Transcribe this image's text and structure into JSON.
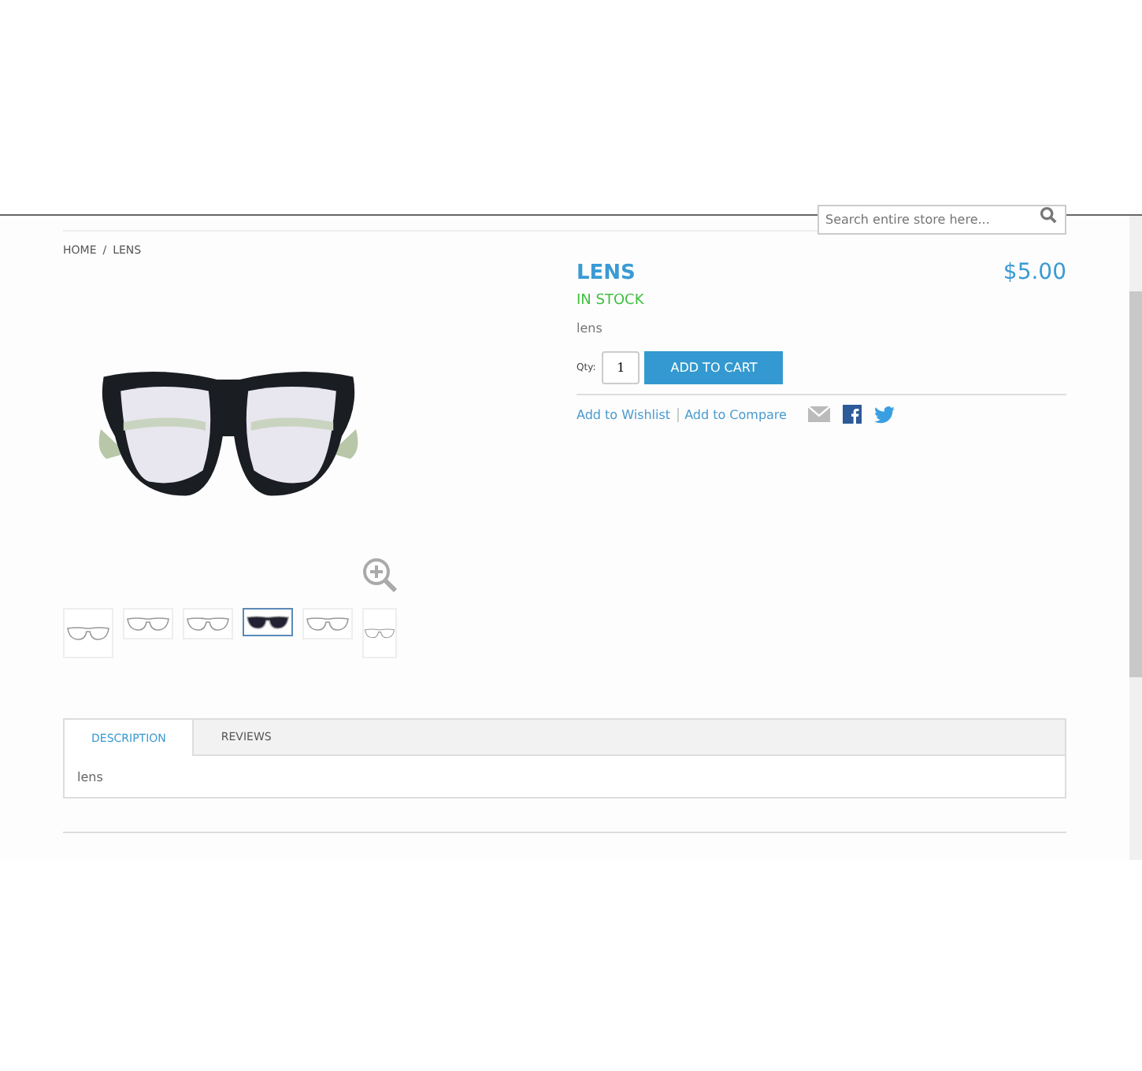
{
  "search": {
    "placeholder": "Search entire store here..."
  },
  "breadcrumbs": [
    "HOME",
    "LENS"
  ],
  "breadcrumb_separator": "/",
  "product": {
    "name": "LENS",
    "price": "$5.00",
    "stock": "IN STOCK",
    "short_description": "lens",
    "qty_label": "Qty:",
    "qty": "1",
    "add_to_cart": "ADD TO CART",
    "links": [
      "Add to Wishlist",
      "Add to Compare"
    ]
  },
  "thumbnails": [
    {
      "selected": false
    },
    {
      "selected": false
    },
    {
      "selected": false
    },
    {
      "selected": true
    },
    {
      "selected": false
    },
    {
      "selected": false
    }
  ],
  "tabs": [
    {
      "label": "DESCRIPTION",
      "selected": true
    },
    {
      "label": "REVIEWS",
      "selected": false
    }
  ],
  "tab_content": "lens"
}
